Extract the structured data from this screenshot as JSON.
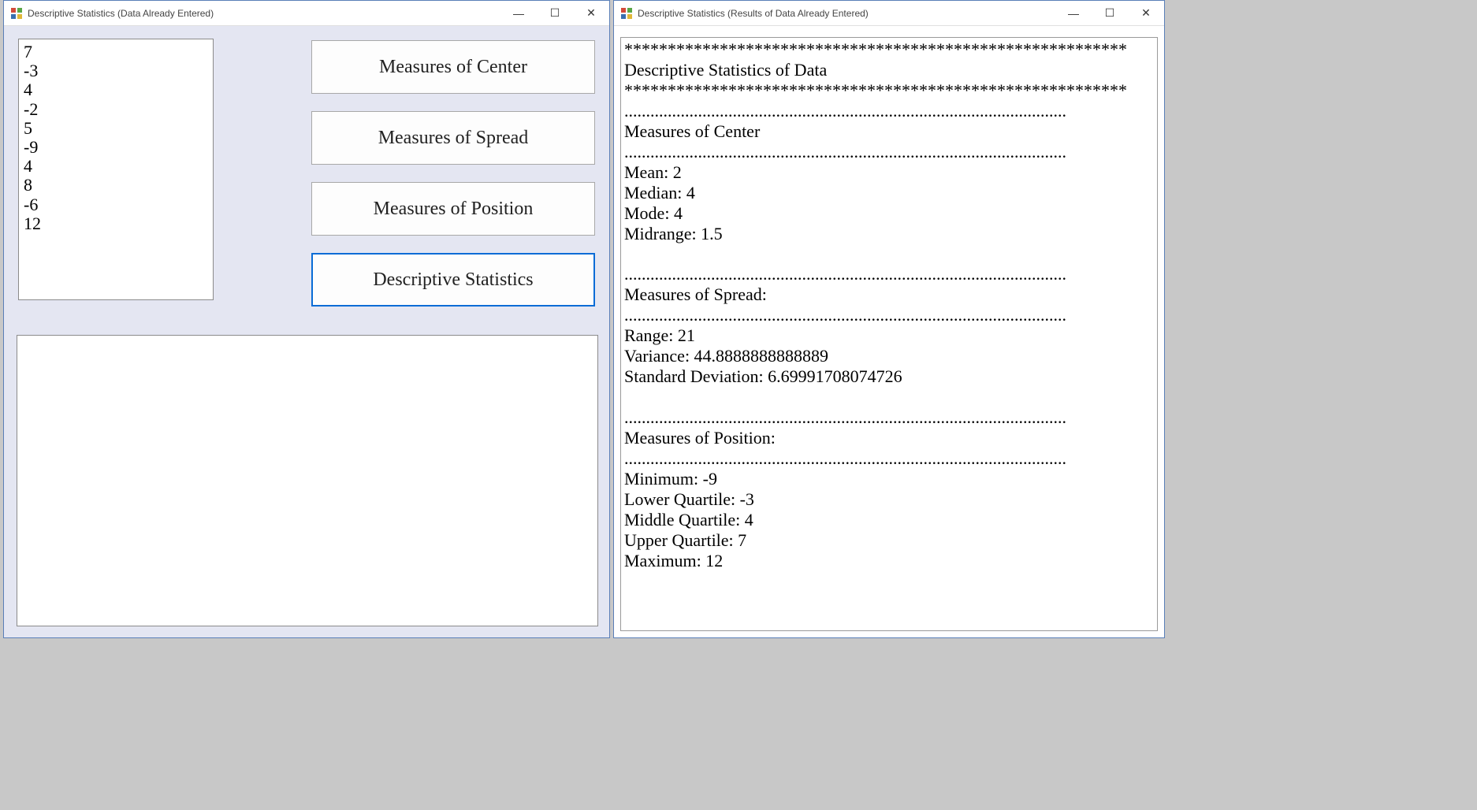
{
  "left_window": {
    "title": "Descriptive Statistics (Data Already Entered)",
    "data_values": [
      "7",
      "-3",
      "4",
      "-2",
      "5",
      "-9",
      "4",
      "8",
      "-6",
      "12"
    ],
    "buttons": {
      "measures_center": "Measures of Center",
      "measures_spread": "Measures of Spread",
      "measures_position": "Measures of Position",
      "descriptive_stats": "Descriptive Statistics"
    },
    "output": ""
  },
  "right_window": {
    "title": "Descriptive Statistics (Results of Data Already Entered)",
    "results": {
      "star_line": "**********************************************************",
      "header": "Descriptive Statistics of Data",
      "dot_line": "......................................................................................................",
      "center_heading": "Measures of Center",
      "center": {
        "mean_label": "Mean:",
        "mean_value": "2",
        "median_label": "Median:",
        "median_value": "4",
        "mode_label": "Mode:",
        "mode_value": "4",
        "midrange_label": "Midrange:",
        "midrange_value": "1.5"
      },
      "spread_heading": "Measures of Spread:",
      "spread": {
        "range_label": "Range:",
        "range_value": "21",
        "variance_label": "Variance:",
        "variance_value": "44.8888888888889",
        "stddev_label": "Standard Deviation:",
        "stddev_value": "6.69991708074726"
      },
      "position_heading": "Measures of Position:",
      "position": {
        "min_label": "Minimum:",
        "min_value": "-9",
        "lq_label": "Lower Quartile:",
        "lq_value": "-3",
        "mq_label": "Middle Quartile:",
        "mq_value": "4",
        "uq_label": "Upper Quartile:",
        "uq_value": "7",
        "max_label": "Maximum:",
        "max_value": "12"
      }
    }
  },
  "win_controls": {
    "minimize": "—",
    "maximize": "☐",
    "close": "✕"
  }
}
